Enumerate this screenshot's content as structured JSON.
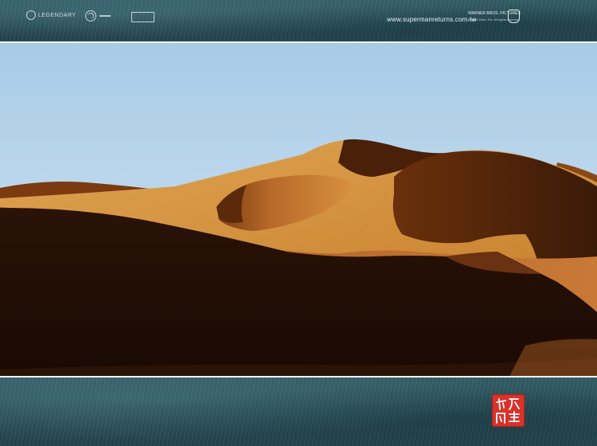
{
  "header": {
    "logo_legendary": "LEGENDARY",
    "url": "www.supermanreturns.com.tw",
    "studio": "WARNER BROS. PICTURES",
    "studio_fine": "Warner Bros. Ent. All rights reserved."
  },
  "photo": {
    "subject": "sand-dunes",
    "colors": {
      "sky": "#a9cde8",
      "sand": "#d9923f",
      "shadow": "#1e0d05"
    }
  },
  "seal": {
    "color": "#d8322a"
  }
}
